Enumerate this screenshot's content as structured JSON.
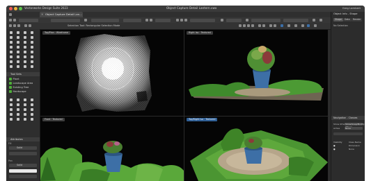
{
  "app": {
    "name": "Vectorworks Design Suite 2023",
    "window_title": "Object Capture Detail Lantern.vwx",
    "user_status": "Greg Lambert",
    "document_tab": "Object Capture Detail Lan..."
  },
  "toolbar": {
    "mode_hint": "Selection Tool: Rectangular Selection Mode"
  },
  "palettes": {
    "tool_set_header": "Tool Sets",
    "tool_set_items": [
      {
        "label": "Plant",
        "icon": "plant-icon"
      },
      {
        "label": "Landscape Area",
        "icon": "landscape-icon"
      },
      {
        "label": "Existing Tree",
        "icon": "tree-icon"
      },
      {
        "label": "Hardscape",
        "icon": "hardscape-icon"
      }
    ],
    "attributes_header": "Attributes",
    "attributes_fill_label": "Fill",
    "attributes_fill_value": "Solid",
    "attributes_pen_label": "Pen",
    "attributes_pen_value": "Solid"
  },
  "viewports": [
    {
      "label": "Top/Plan · Wireframe",
      "active": false
    },
    {
      "label": "Right Iso · Textured",
      "active": false
    },
    {
      "label": "Front · Textured",
      "active": false
    },
    {
      "label": "Top/Right Iso · Textured",
      "active": true
    }
  ],
  "right_panel": {
    "title": "Object Info - Shape",
    "tabs": [
      "Shape",
      "Data",
      "Render"
    ],
    "empty_message": "No Selection",
    "navigation_header": "Navigation - Classes",
    "nav_rows": [
      {
        "label": "Show Others",
        "value": "Show/Snap/Modify Others"
      },
      {
        "label": "Active",
        "value": "None"
      }
    ],
    "nav_columns": [
      "Visibility",
      "Class Name"
    ],
    "nav_classes": [
      "Dimension",
      "None"
    ]
  },
  "colors": {
    "accent": "#2f5f95",
    "panel": "#2c2c2c",
    "viewport_bg": "#050505",
    "foliage": "#4fae3a"
  }
}
